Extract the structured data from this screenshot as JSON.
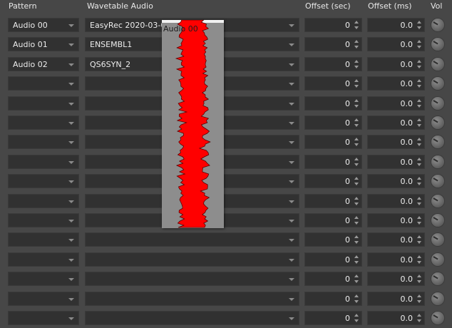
{
  "headers": {
    "pattern": "Pattern",
    "wavetable": "Wavetable Audio",
    "offset_sec": "Offset (sec)",
    "offset_ms": "Offset (ms)",
    "vol": "Vol"
  },
  "rows": [
    {
      "pattern": "Audio 00",
      "audio": "EasyRec 2020-03-04",
      "offset_sec": "0",
      "offset_ms": "0.0"
    },
    {
      "pattern": "Audio 01",
      "audio": "ENSEMBL1",
      "offset_sec": "0",
      "offset_ms": "0.0"
    },
    {
      "pattern": "Audio 02",
      "audio": "QS6SYN_2",
      "offset_sec": "0",
      "offset_ms": "0.0"
    },
    {
      "pattern": "",
      "audio": "",
      "offset_sec": "0",
      "offset_ms": "0.0"
    },
    {
      "pattern": "",
      "audio": "",
      "offset_sec": "0",
      "offset_ms": "0.0"
    },
    {
      "pattern": "",
      "audio": "",
      "offset_sec": "0",
      "offset_ms": "0.0"
    },
    {
      "pattern": "",
      "audio": "",
      "offset_sec": "0",
      "offset_ms": "0.0"
    },
    {
      "pattern": "",
      "audio": "",
      "offset_sec": "0",
      "offset_ms": "0.0"
    },
    {
      "pattern": "",
      "audio": "",
      "offset_sec": "0",
      "offset_ms": "0.0"
    },
    {
      "pattern": "",
      "audio": "",
      "offset_sec": "0",
      "offset_ms": "0.0"
    },
    {
      "pattern": "",
      "audio": "",
      "offset_sec": "0",
      "offset_ms": "0.0"
    },
    {
      "pattern": "",
      "audio": "",
      "offset_sec": "0",
      "offset_ms": "0.0"
    },
    {
      "pattern": "",
      "audio": "",
      "offset_sec": "0",
      "offset_ms": "0.0"
    },
    {
      "pattern": "",
      "audio": "",
      "offset_sec": "0",
      "offset_ms": "0.0"
    },
    {
      "pattern": "",
      "audio": "",
      "offset_sec": "0",
      "offset_ms": "0.0"
    },
    {
      "pattern": "",
      "audio": "",
      "offset_sec": "0",
      "offset_ms": "0.0"
    }
  ],
  "preview": {
    "title": "Audio 00",
    "waveform_color": "#ff0000",
    "background_color": "#8d8d8d"
  },
  "icons": {
    "dropdown": "chevron-down-icon",
    "spin_up": "spin-up-icon",
    "spin_down": "spin-down-icon",
    "volume": "volume-knob-icon"
  }
}
